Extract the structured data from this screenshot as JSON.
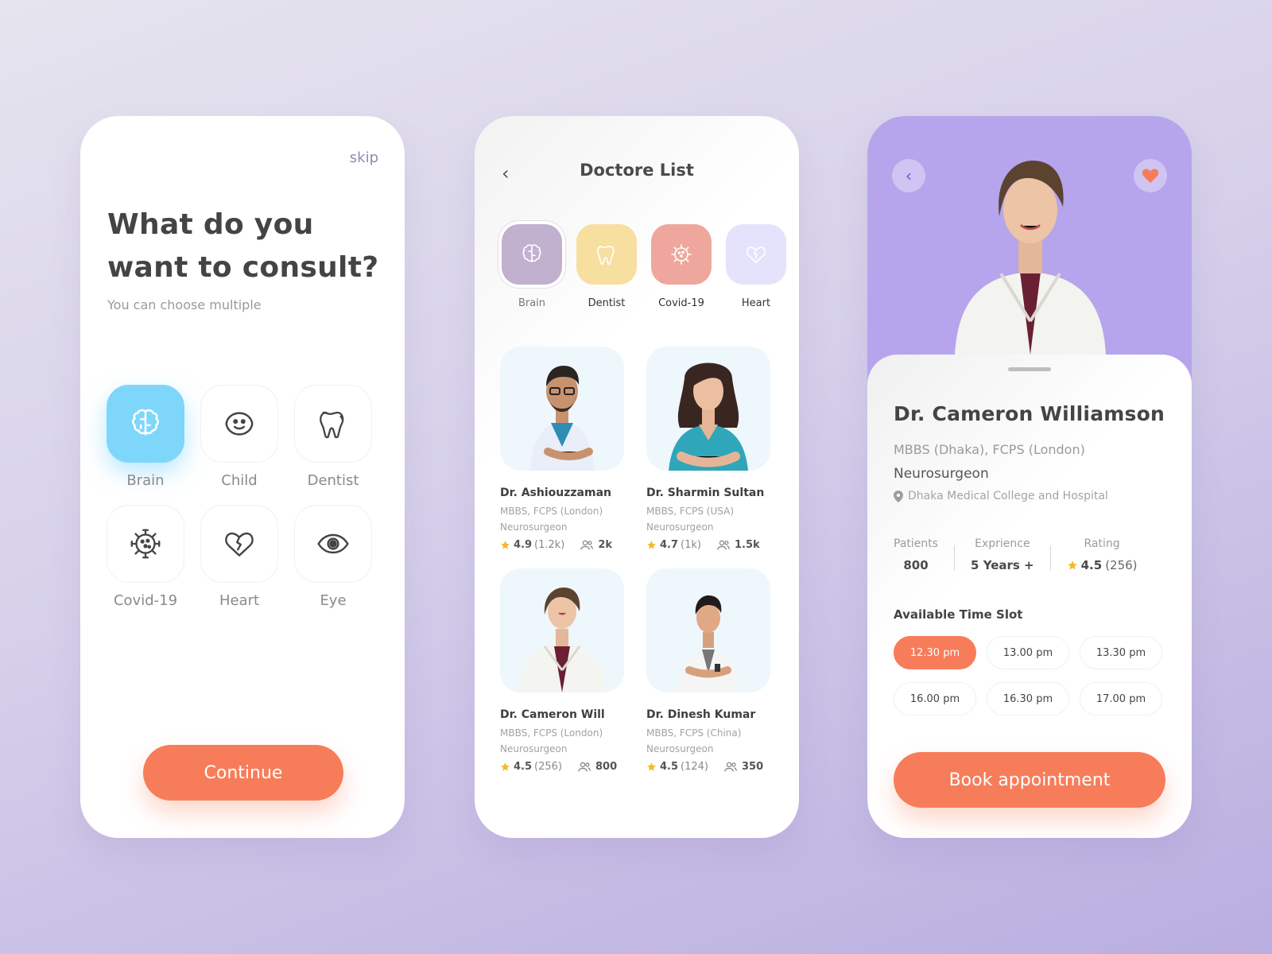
{
  "colors": {
    "accent": "#f77d5a",
    "selected_category": "#7fd6fb",
    "profile_header": "#b6a5ec",
    "star": "#f5b82e"
  },
  "screen1": {
    "skip_label": "skip",
    "title_line1": "What do you",
    "title_line2": "want to consult?",
    "subtitle": "You can choose multiple",
    "categories": [
      {
        "label": "Brain",
        "icon": "brain-icon",
        "selected": true
      },
      {
        "label": "Child",
        "icon": "child-face-icon",
        "selected": false
      },
      {
        "label": "Dentist",
        "icon": "tooth-icon",
        "selected": false
      },
      {
        "label": "Covid-19",
        "icon": "virus-icon",
        "selected": false
      },
      {
        "label": "Heart",
        "icon": "broken-heart-icon",
        "selected": false
      },
      {
        "label": "Eye",
        "icon": "eye-icon",
        "selected": false
      }
    ],
    "continue_label": "Continue"
  },
  "screen2": {
    "title": "Doctore List",
    "back_icon": "chevron-left-icon",
    "chips": [
      {
        "label": "Brain",
        "icon": "brain-icon",
        "color": "#c2b0cf",
        "selected": true
      },
      {
        "label": "Dentist",
        "icon": "tooth-icon",
        "color": "#f7df9f",
        "selected": false
      },
      {
        "label": "Covid-19",
        "icon": "virus-icon",
        "color": "#efa79d",
        "selected": false
      },
      {
        "label": "Heart",
        "icon": "broken-heart-icon",
        "color": "#e5e3fb",
        "selected": false
      }
    ],
    "doctors": [
      {
        "name": "Dr. Ashiouzzaman",
        "degree": "MBBS, FCPS (London)",
        "specialty": "Neurosurgeon",
        "rating": "4.9",
        "reviews": "(1.2k)",
        "patients": "2k"
      },
      {
        "name": "Dr. Sharmin Sultan",
        "degree": "MBBS, FCPS (USA)",
        "specialty": "Neurosurgeon",
        "rating": "4.7",
        "reviews": "(1k)",
        "patients": "1.5k"
      },
      {
        "name": "Dr. Cameron Will",
        "degree": "MBBS, FCPS (London)",
        "specialty": "Neurosurgeon",
        "rating": "4.5",
        "reviews": "(256)",
        "patients": "800"
      },
      {
        "name": "Dr. Dinesh Kumar",
        "degree": "MBBS, FCPS (China)",
        "specialty": "Neurosurgeon",
        "rating": "4.5",
        "reviews": "(124)",
        "patients": "350"
      }
    ]
  },
  "screen3": {
    "back_icon": "chevron-left-icon",
    "favorite_icon": "heart-icon",
    "name": "Dr. Cameron Williamson",
    "degree": "MBBS (Dhaka), FCPS (London)",
    "specialty": "Neurosurgeon",
    "location": "Dhaka Medical College and Hospital",
    "stats": {
      "patients_label": "Patients",
      "patients_value": "800",
      "experience_label": "Exprience",
      "experience_value": "5 Years +",
      "rating_label": "Rating",
      "rating_value": "4.5",
      "rating_count": "(256)"
    },
    "slots_title": "Available Time Slot",
    "slots": [
      {
        "label": "12.30 pm",
        "selected": true
      },
      {
        "label": "13.00 pm",
        "selected": false
      },
      {
        "label": "13.30 pm",
        "selected": false
      },
      {
        "label": "16.00 pm",
        "selected": false
      },
      {
        "label": "16.30 pm",
        "selected": false
      },
      {
        "label": "17.00 pm",
        "selected": false
      }
    ],
    "book_label": "Book appointment"
  }
}
